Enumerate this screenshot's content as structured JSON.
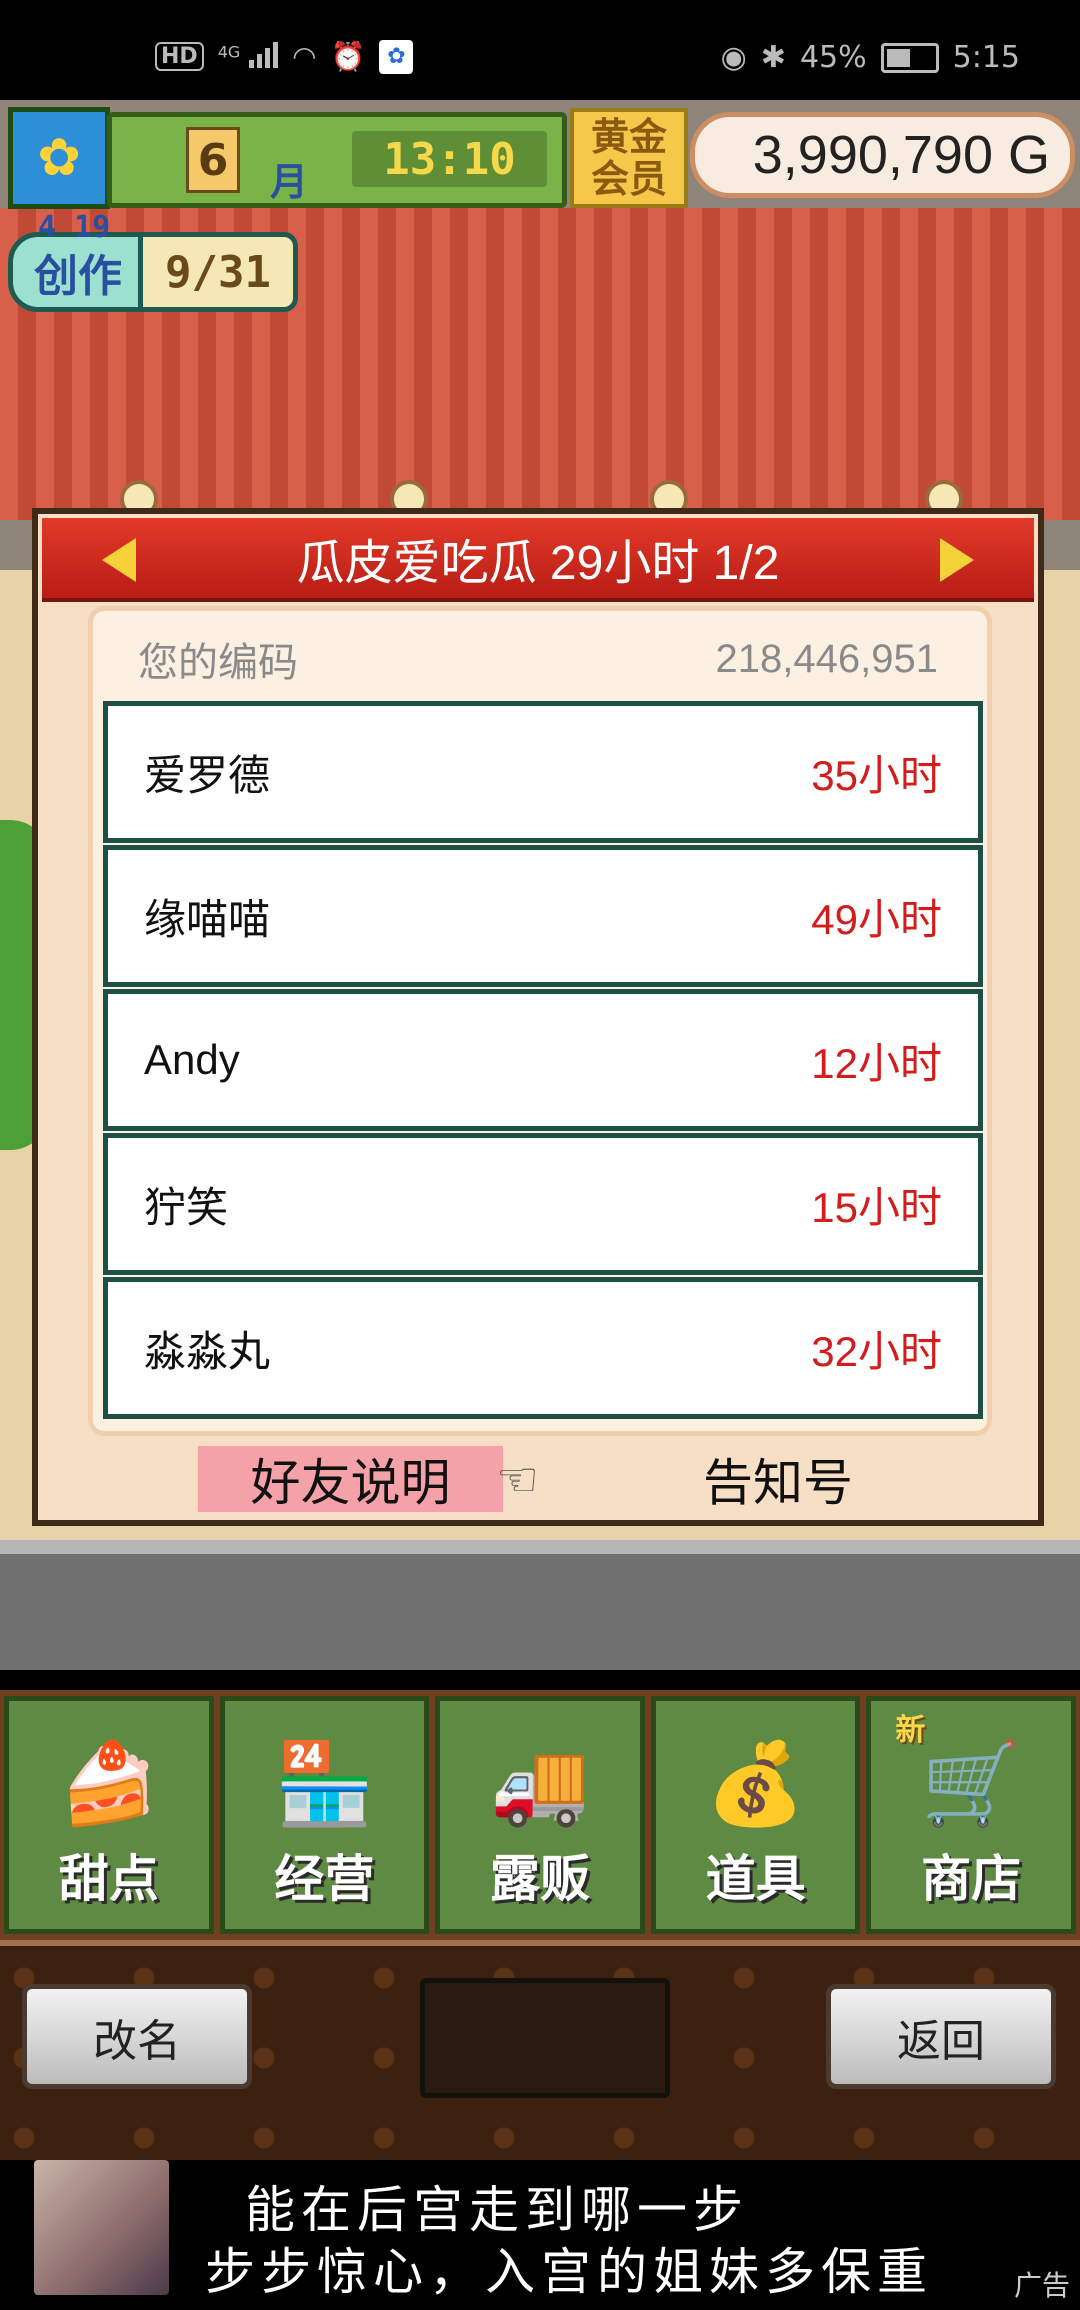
{
  "status_bar": {
    "network_label": "HD",
    "signal_label": "4G",
    "battery_percent": "45%",
    "time": "5:15"
  },
  "hud": {
    "season_icon": "sunflower-icon",
    "month_number": "6",
    "month_label": "月",
    "clock": "13:10",
    "gold_member_label": "黄金会员",
    "money": "3,990,790 G"
  },
  "create_badge": {
    "date": "4 19",
    "label": "创作",
    "count": "9/31"
  },
  "dialog": {
    "title": "瓜皮爱吃瓜  29小时 1/2",
    "my_code_label": "您的编码",
    "my_code_value": "218,446,951",
    "friends": [
      {
        "name": "爱罗德",
        "hours": "35小时"
      },
      {
        "name": "缘喵喵",
        "hours": "49小时"
      },
      {
        "name": "Andy",
        "hours": "12小时"
      },
      {
        "name": "狞笑",
        "hours": "15小时"
      },
      {
        "name": "淼淼丸",
        "hours": "32小时"
      }
    ],
    "explain_button": "好友说明",
    "notice_button": "告知号"
  },
  "nav": [
    {
      "label": "甜点",
      "icon": "cake-icon"
    },
    {
      "label": "经营",
      "icon": "shop-icon"
    },
    {
      "label": "露贩",
      "icon": "food-truck-icon"
    },
    {
      "label": "道具",
      "icon": "item-bag-icon"
    },
    {
      "label": "商店",
      "icon": "shopping-cart-icon",
      "tag": "新"
    }
  ],
  "bottom": {
    "rename_button": "改名",
    "back_button": "返回"
  },
  "ad": {
    "line1": "能在后宫走到哪一步",
    "line2": "步步惊心，入宫的姐妹多保重",
    "tag": "广告"
  }
}
